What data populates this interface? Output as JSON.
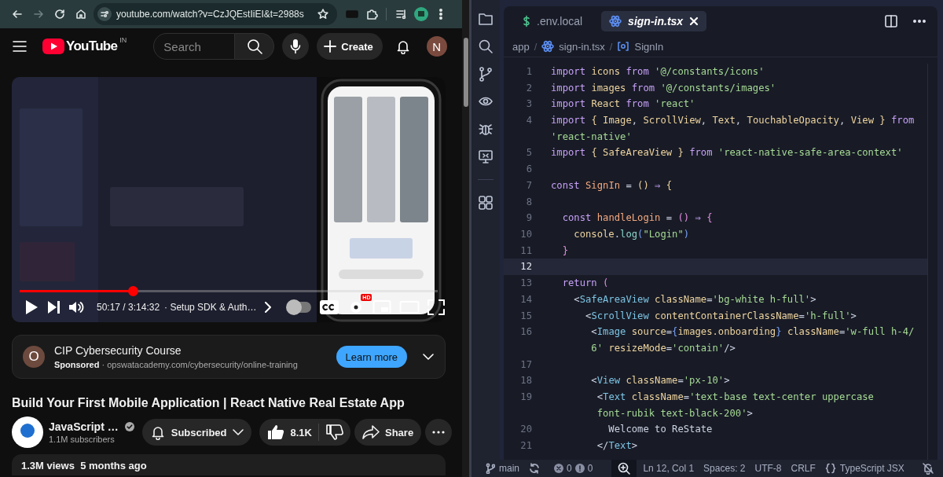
{
  "browser": {
    "url": "youtube.com/watch?v=CzJQEstIiEI&t=2988s",
    "forward_disabled": true
  },
  "youtube": {
    "logo": "YouTube",
    "country": "IN",
    "search": {
      "placeholder": "Search"
    },
    "create": "Create",
    "avatar": "N"
  },
  "player": {
    "time": "50:17 / 3:14:32",
    "chapter": "· Setup SDK & Auth…",
    "progress": {
      "level": 0.27
    },
    "autoplay": false,
    "quality_badge": "HD"
  },
  "ad": {
    "avatar": "O",
    "title": "CIP Cybersecurity Course",
    "line": "**Sponsored** · opswatacademy.com/cybersecurity/online-training",
    "button": "Learn more"
  },
  "video": {
    "title": "Build Your First Mobile Application | React Native Real Estate App",
    "channel": "JavaScript …",
    "verified": true,
    "subscribers": "1.1M subscribers",
    "subscribe_button": "Subscribed",
    "likes": "8.1K",
    "share": "Share",
    "views": "1.3M views  5 months ago"
  },
  "editor": {
    "tabs": [
      {
        "label": ".env.local",
        "kind": "env",
        "selected": false
      },
      {
        "label": "sign-in.tsx",
        "kind": "react",
        "selected": true
      }
    ],
    "breadcrumb": [
      {
        "label": "app",
        "kind": "folder"
      },
      {
        "separator": "/",
        "label": "sign-in.tsx",
        "kind": "react"
      },
      {
        "separator": "/",
        "label": "SignIn",
        "kind": "symbol"
      }
    ],
    "lines": [
      {
        "number": "1",
        "current": false,
        "rows": [
          {
            "tokens": [
              {
                "kind": "keyword",
                "text": "import "
              },
              {
                "kind": "ident",
                "text": "icons "
              },
              {
                "kind": "keyword",
                "text": "from "
              },
              {
                "kind": "string",
                "text": "'@/constants/icons'"
              }
            ]
          }
        ]
      },
      {
        "number": "2",
        "current": false,
        "rows": [
          {
            "tokens": [
              {
                "kind": "keyword",
                "text": "import "
              },
              {
                "kind": "ident",
                "text": "images "
              },
              {
                "kind": "keyword",
                "text": "from "
              },
              {
                "kind": "string",
                "text": "'@/constants/images'"
              }
            ]
          }
        ]
      },
      {
        "number": "3",
        "current": false,
        "rows": [
          {
            "tokens": [
              {
                "kind": "keyword",
                "text": "import "
              },
              {
                "kind": "ident",
                "text": "React "
              },
              {
                "kind": "keyword",
                "text": "from "
              },
              {
                "kind": "string",
                "text": "'react'"
              }
            ]
          }
        ]
      },
      {
        "number": "4",
        "current": false,
        "rows": [
          {
            "tokens": [
              {
                "kind": "keyword",
                "text": "import "
              },
              {
                "kind": "brace",
                "text": "{ "
              },
              {
                "kind": "ident",
                "text": "Image"
              },
              {
                "kind": "plain",
                "text": ", "
              },
              {
                "kind": "ident",
                "text": "ScrollView"
              },
              {
                "kind": "plain",
                "text": ", "
              },
              {
                "kind": "ident",
                "text": "Text"
              },
              {
                "kind": "plain",
                "text": ", "
              },
              {
                "kind": "ident",
                "text": "TouchableOpacity"
              },
              {
                "kind": "plain",
                "text": ", "
              },
              {
                "kind": "ident",
                "text": "View "
              },
              {
                "kind": "brace",
                "text": "} "
              },
              {
                "kind": "keyword",
                "text": "from"
              }
            ]
          },
          {
            "tokens": [
              {
                "kind": "string",
                "text": "'react-native'"
              }
            ]
          }
        ]
      },
      {
        "number": "5",
        "current": false,
        "rows": [
          {
            "tokens": [
              {
                "kind": "keyword",
                "text": "import "
              },
              {
                "kind": "brace",
                "text": "{ "
              },
              {
                "kind": "ident",
                "text": "SafeAreaView "
              },
              {
                "kind": "brace",
                "text": "} "
              },
              {
                "kind": "keyword",
                "text": "from "
              },
              {
                "kind": "string",
                "text": "'react-native-safe-area-context'"
              }
            ]
          }
        ]
      },
      {
        "number": "6",
        "current": false,
        "rows": [
          {
            "tokens": []
          }
        ]
      },
      {
        "number": "7",
        "current": false,
        "rows": [
          {
            "tokens": [
              {
                "kind": "keyword",
                "text": "const "
              },
              {
                "kind": "func",
                "text": "SignIn"
              },
              {
                "kind": "plain",
                "text": " = "
              },
              {
                "kind": "brace",
                "text": "() "
              },
              {
                "kind": "keyword",
                "text": "⇒ "
              },
              {
                "kind": "brace",
                "text": "{"
              }
            ]
          }
        ]
      },
      {
        "number": "8",
        "current": false,
        "rows": [
          {
            "tokens": []
          }
        ]
      },
      {
        "number": "9",
        "current": false,
        "rows": [
          {
            "tokens": [
              {
                "kind": "keyword",
                "text": "  const "
              },
              {
                "kind": "func",
                "text": "handleLogin"
              },
              {
                "kind": "plain",
                "text": " = "
              },
              {
                "kind": "paren",
                "text": "() "
              },
              {
                "kind": "keyword",
                "text": "⇒ "
              },
              {
                "kind": "paren",
                "text": "{"
              }
            ]
          }
        ]
      },
      {
        "number": "10",
        "current": false,
        "rows": [
          {
            "tokens": [
              {
                "kind": "ident",
                "text": "    console"
              },
              {
                "kind": "plain",
                "text": "."
              },
              {
                "kind": "method",
                "text": "log"
              },
              {
                "kind": "bracket",
                "text": "("
              },
              {
                "kind": "string",
                "text": "\"Login\""
              },
              {
                "kind": "bracket",
                "text": ")"
              }
            ]
          }
        ]
      },
      {
        "number": "11",
        "current": false,
        "rows": [
          {
            "tokens": [
              {
                "kind": "paren",
                "text": "  }"
              }
            ]
          }
        ]
      },
      {
        "number": "12",
        "current": true,
        "rows": [
          {
            "tokens": []
          }
        ]
      },
      {
        "number": "13",
        "current": false,
        "rows": [
          {
            "tokens": [
              {
                "kind": "keyword",
                "text": "  return "
              },
              {
                "kind": "paren",
                "text": "("
              }
            ]
          }
        ]
      },
      {
        "number": "14",
        "current": false,
        "rows": [
          {
            "tokens": [
              {
                "kind": "plain",
                "text": "    <"
              },
              {
                "kind": "tag",
                "text": "SafeAreaView "
              },
              {
                "kind": "attr",
                "text": "className"
              },
              {
                "kind": "plain",
                "text": "="
              },
              {
                "kind": "string",
                "text": "'bg-white h-full'"
              },
              {
                "kind": "plain",
                "text": ">"
              }
            ]
          }
        ]
      },
      {
        "number": "15",
        "current": false,
        "rows": [
          {
            "tokens": [
              {
                "kind": "plain",
                "text": "      <"
              },
              {
                "kind": "tag",
                "text": "ScrollView "
              },
              {
                "kind": "attr",
                "text": "contentContainerClassName"
              },
              {
                "kind": "plain",
                "text": "="
              },
              {
                "kind": "string",
                "text": "'h-full'"
              },
              {
                "kind": "plain",
                "text": ">"
              }
            ]
          }
        ]
      },
      {
        "number": "16",
        "current": false,
        "rows": [
          {
            "tokens": [
              {
                "kind": "plain",
                "text": "       <"
              },
              {
                "kind": "tag",
                "text": "Image "
              },
              {
                "kind": "attr",
                "text": "source"
              },
              {
                "kind": "plain",
                "text": "="
              },
              {
                "kind": "bracket",
                "text": "{"
              },
              {
                "kind": "ident",
                "text": "images.onboarding"
              },
              {
                "kind": "bracket",
                "text": "} "
              },
              {
                "kind": "attr",
                "text": "className"
              },
              {
                "kind": "plain",
                "text": "="
              },
              {
                "kind": "string",
                "text": "'w-full h-4/"
              }
            ]
          },
          {
            "tokens": [
              {
                "kind": "string",
                "text": "       6' "
              },
              {
                "kind": "attr",
                "text": "resizeMode"
              },
              {
                "kind": "plain",
                "text": "="
              },
              {
                "kind": "string",
                "text": "'contain'"
              },
              {
                "kind": "plain",
                "text": "/>"
              }
            ]
          }
        ]
      },
      {
        "number": "17",
        "current": false,
        "rows": [
          {
            "tokens": []
          }
        ]
      },
      {
        "number": "18",
        "current": false,
        "rows": [
          {
            "tokens": [
              {
                "kind": "plain",
                "text": "       <"
              },
              {
                "kind": "tag",
                "text": "View "
              },
              {
                "kind": "attr",
                "text": "className"
              },
              {
                "kind": "plain",
                "text": "="
              },
              {
                "kind": "string",
                "text": "'px-10'"
              },
              {
                "kind": "plain",
                "text": ">"
              }
            ]
          }
        ]
      },
      {
        "number": "19",
        "current": false,
        "rows": [
          {
            "tokens": [
              {
                "kind": "plain",
                "text": "        <"
              },
              {
                "kind": "tag",
                "text": "Text "
              },
              {
                "kind": "attr",
                "text": "className"
              },
              {
                "kind": "plain",
                "text": "="
              },
              {
                "kind": "string",
                "text": "'text-base text-center uppercase"
              }
            ]
          },
          {
            "tokens": [
              {
                "kind": "string",
                "text": "        font-rubik text-black-200'"
              },
              {
                "kind": "plain",
                "text": ">"
              }
            ]
          }
        ]
      },
      {
        "number": "20",
        "current": false,
        "rows": [
          {
            "tokens": [
              {
                "kind": "plain",
                "text": "          Welcome to ReState"
              }
            ]
          }
        ]
      },
      {
        "number": "21",
        "current": false,
        "rows": [
          {
            "tokens": [
              {
                "kind": "plain",
                "text": "        </"
              },
              {
                "kind": "tag",
                "text": "Text"
              },
              {
                "kind": "plain",
                "text": ">"
              }
            ]
          }
        ]
      }
    ]
  },
  "status_bar": {
    "branch": "main",
    "errors": "0",
    "warnings": "0",
    "items": [
      "Ln 12, Col 1",
      "Spaces: 2",
      "UTF-8",
      "CRLF"
    ],
    "language": "TypeScript JSX"
  }
}
